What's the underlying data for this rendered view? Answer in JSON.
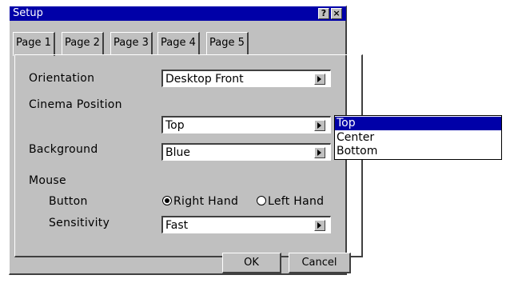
{
  "window": {
    "title": "Setup",
    "help_label": "?",
    "close_label": "×"
  },
  "tabs": [
    {
      "label": "Page 1",
      "active": true
    },
    {
      "label": "Page 2",
      "active": false
    },
    {
      "label": "Page 3",
      "active": false
    },
    {
      "label": "Page 4",
      "active": false
    },
    {
      "label": "Page 5",
      "active": false
    }
  ],
  "settings": {
    "orientation": {
      "label": "Orientation",
      "value": "Desktop Front"
    },
    "cinema_position": {
      "label": "Cinema Position",
      "value": "Top"
    },
    "background": {
      "label": "Background",
      "value": "Blue"
    },
    "mouse": {
      "label": "Mouse",
      "button": {
        "label": "Button",
        "right_hand": "Right Hand",
        "left_hand": "Left Hand",
        "selected": "Right Hand"
      },
      "sensitivity": {
        "label": "Sensitivity",
        "value": "Fast"
      }
    }
  },
  "dropdown": {
    "options": [
      "Top",
      "Center",
      "Bottom"
    ],
    "selected": "Top"
  },
  "buttons": {
    "ok": "OK",
    "cancel": "Cancel"
  },
  "colors": {
    "title_bar": "#0000a8",
    "selection": "#0000a8",
    "window_bg": "#c0c0c0"
  }
}
